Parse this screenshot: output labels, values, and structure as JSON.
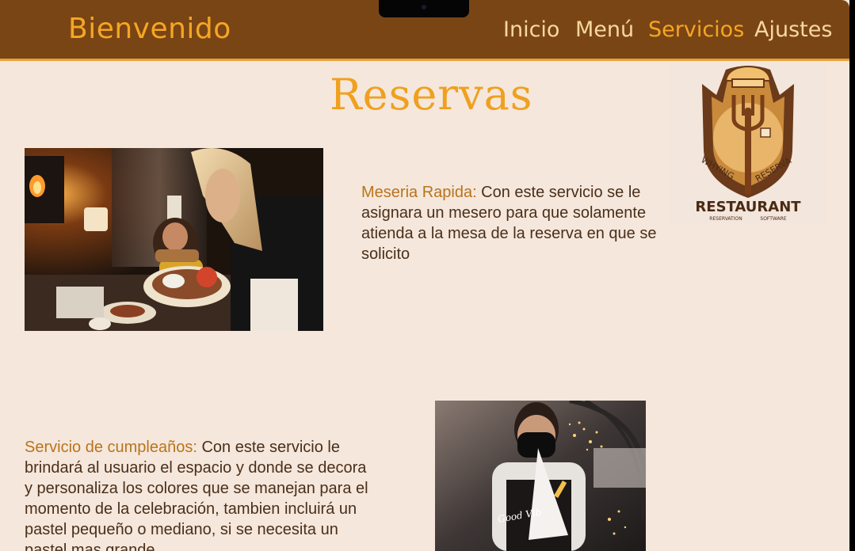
{
  "header": {
    "brand": "Bienvenido",
    "nav": [
      {
        "label": "Inicio",
        "active": false
      },
      {
        "label": "Menú",
        "active": false
      },
      {
        "label": "Servicios",
        "active": true
      },
      {
        "label": "Ajustes",
        "active": false
      }
    ]
  },
  "page": {
    "title": "Reservas"
  },
  "logo": {
    "top_arc": "WHYING RESERVA",
    "name": "RESTAURANT",
    "tagline_left": "RESERVATION",
    "tagline_right": "SOFTWARE"
  },
  "services": [
    {
      "label": "Meseria Rapida:",
      "text": " Con este servicio se le asignara un mesero para que solamente atienda a la mesa de la reserva en que se solicito"
    },
    {
      "label": "Servicio de cumpleaños:",
      "text": " Con este servicio le brindará al usuario el espacio y donde se decora  y personaliza los colores que se manejan para el momento de la celebración, tambien incluirá un pastel pequeño o mediano, si se necesita un pastel mas grande"
    }
  ],
  "photo2": {
    "apron_text": "Good Vib"
  },
  "colors": {
    "header": "#7a4514",
    "accent": "#f5a623",
    "background": "#f5e7dc",
    "label": "#b8741c"
  }
}
